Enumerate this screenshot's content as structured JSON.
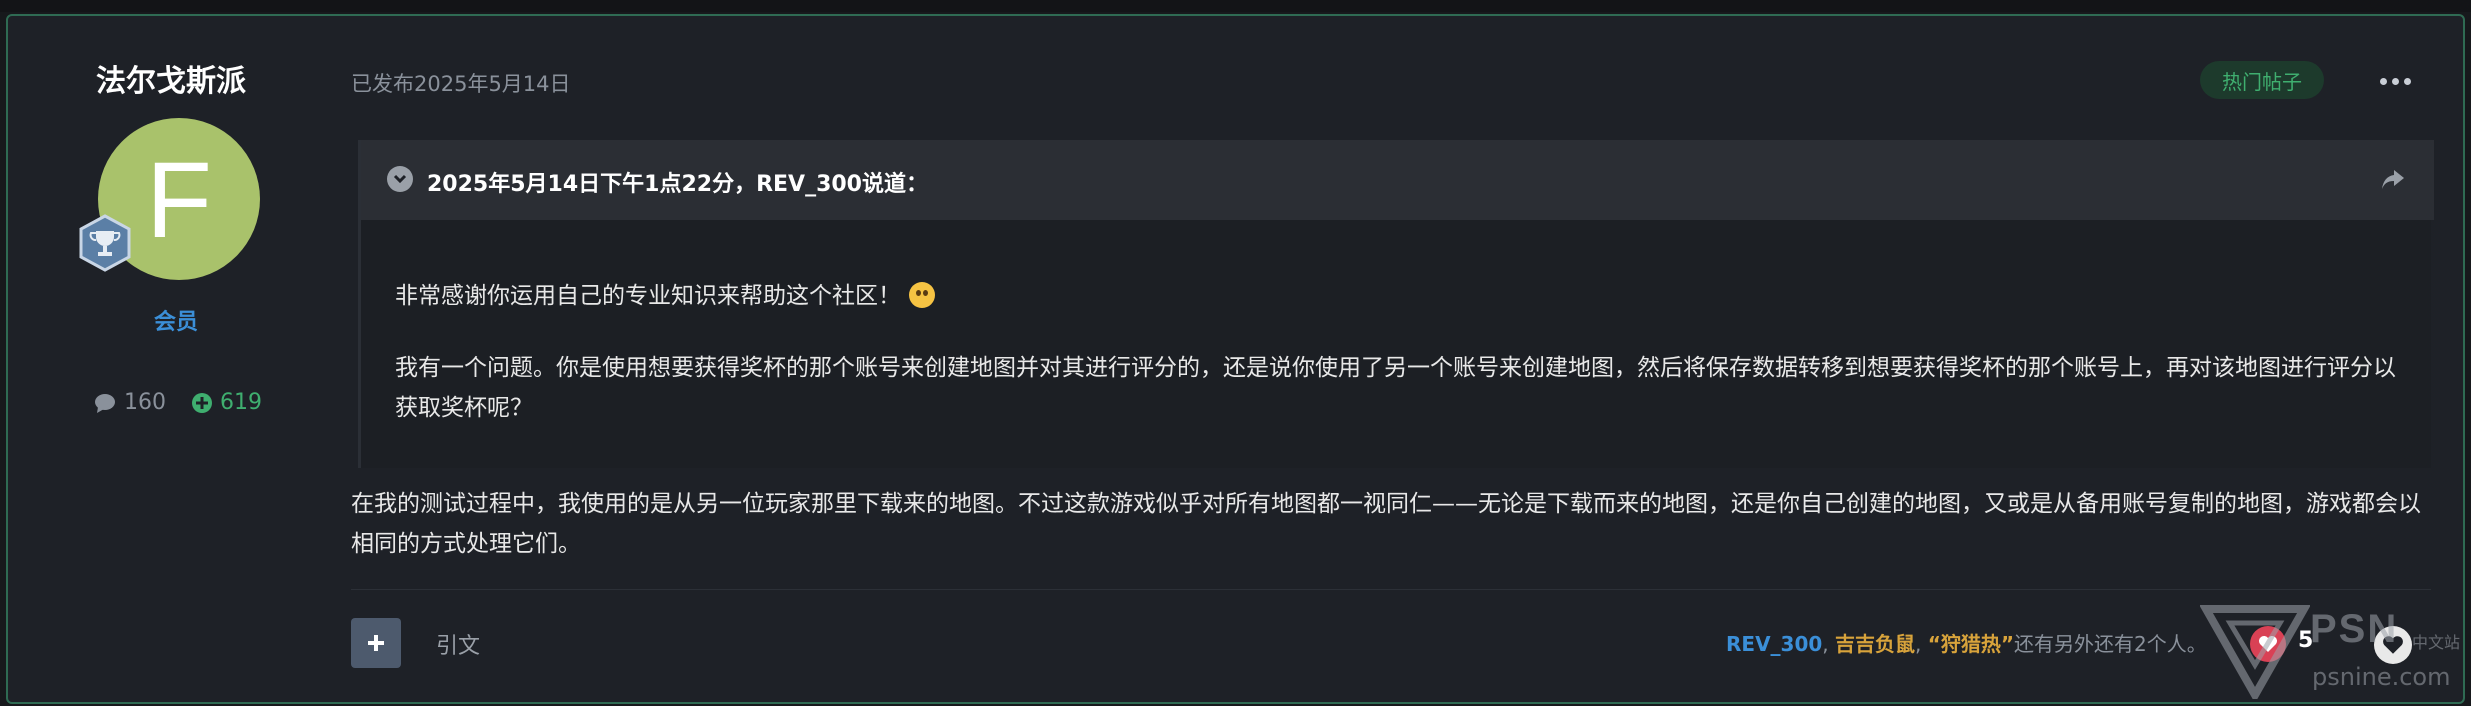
{
  "author": {
    "name": "法尔戈斯派",
    "avatar_letter": "F",
    "avatar_color": "#a9c26b",
    "role": "会员",
    "comments": "160",
    "reputation": "619"
  },
  "post": {
    "posted": "已发布2025年5月14日",
    "badge": "热门帖子",
    "quote": {
      "cite": "2025年5月14日下午1点22分，REV_300说道：",
      "para1": "非常感谢你运用自己的专业知识来帮助这个社区！",
      "para2": "我有一个问题。你是使用想要获得奖杯的那个账号来创建地图并对其进行评分的，还是说你使用了另一个账号来创建地图，然后将保存数据转移到想要获得奖杯的那个账号上，再对该地图进行评分以获取奖杯呢？"
    },
    "reply": "在我的测试过程中，我使用的是从另一位玩家那里下载来的地图。不过这款游戏似乎对所有地图都一视同仁——无论是下载而来的地图，还是你自己创建的地图，又或是从备用账号复制的地图，游戏都会以相同的方式处理它们。"
  },
  "footer": {
    "quote_label": "引文",
    "reactor_1": "REV_300",
    "sep_1": ", ",
    "reactor_2": "吉吉负鼠",
    "sep_2": ", ",
    "reactor_3": "“狩猎热”",
    "reactors_suffix": "还有另外还有2个人。",
    "reaction_count": "5"
  },
  "watermark": {
    "brand": "PSN",
    "tagline": "中文站",
    "url": "psnine.com"
  },
  "colors": {
    "accent_green": "#3fae6f",
    "link_blue": "#3b8fd8",
    "name_gold": "#d8a33b",
    "heart_red": "#d94155"
  }
}
